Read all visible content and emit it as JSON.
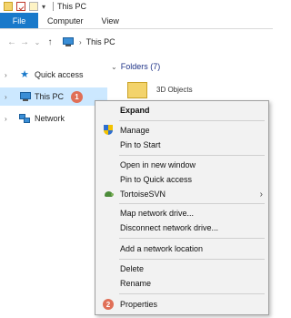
{
  "window": {
    "title": "This PC"
  },
  "ribbon": {
    "tabs": [
      "File",
      "Computer",
      "View"
    ]
  },
  "address": {
    "location": "This PC"
  },
  "nav_pane": {
    "items": [
      {
        "label": "Quick access",
        "icon": "star-icon"
      },
      {
        "label": "This PC",
        "icon": "computer-icon",
        "selected": true,
        "badge": "1"
      },
      {
        "label": "Network",
        "icon": "network-icon"
      }
    ]
  },
  "content": {
    "group_header": "Folders (7)",
    "first_item": "3D Objects"
  },
  "context_menu": {
    "expand": "Expand",
    "manage": "Manage",
    "pin_to_start": "Pin to Start",
    "open_new_window": "Open in new window",
    "pin_quick_access": "Pin to Quick access",
    "tortoisesvn": "TortoiseSVN",
    "map_drive": "Map network drive...",
    "disconnect_drive": "Disconnect network drive...",
    "add_network_location": "Add a network location",
    "delete": "Delete",
    "rename": "Rename",
    "properties": "Properties",
    "properties_badge": "2"
  },
  "colors": {
    "accent": "#1979ca",
    "selection": "#cce8ff",
    "badge": "#e06f57"
  }
}
